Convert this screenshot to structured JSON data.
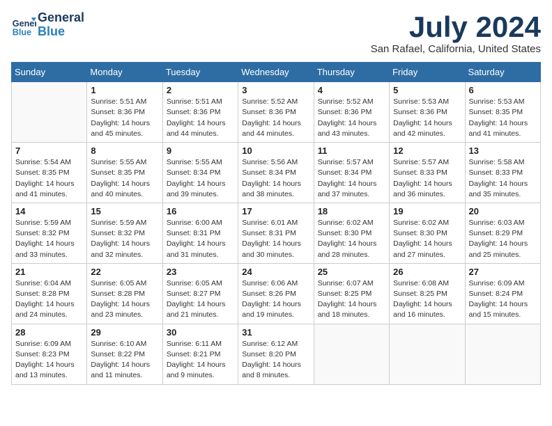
{
  "header": {
    "logo_general": "General",
    "logo_blue": "Blue",
    "month": "July 2024",
    "location": "San Rafael, California, United States"
  },
  "weekdays": [
    "Sunday",
    "Monday",
    "Tuesday",
    "Wednesday",
    "Thursday",
    "Friday",
    "Saturday"
  ],
  "weeks": [
    [
      {
        "day": "",
        "sunrise": "",
        "sunset": "",
        "daylight": ""
      },
      {
        "day": "1",
        "sunrise": "Sunrise: 5:51 AM",
        "sunset": "Sunset: 8:36 PM",
        "daylight": "Daylight: 14 hours and 45 minutes."
      },
      {
        "day": "2",
        "sunrise": "Sunrise: 5:51 AM",
        "sunset": "Sunset: 8:36 PM",
        "daylight": "Daylight: 14 hours and 44 minutes."
      },
      {
        "day": "3",
        "sunrise": "Sunrise: 5:52 AM",
        "sunset": "Sunset: 8:36 PM",
        "daylight": "Daylight: 14 hours and 44 minutes."
      },
      {
        "day": "4",
        "sunrise": "Sunrise: 5:52 AM",
        "sunset": "Sunset: 8:36 PM",
        "daylight": "Daylight: 14 hours and 43 minutes."
      },
      {
        "day": "5",
        "sunrise": "Sunrise: 5:53 AM",
        "sunset": "Sunset: 8:36 PM",
        "daylight": "Daylight: 14 hours and 42 minutes."
      },
      {
        "day": "6",
        "sunrise": "Sunrise: 5:53 AM",
        "sunset": "Sunset: 8:35 PM",
        "daylight": "Daylight: 14 hours and 41 minutes."
      }
    ],
    [
      {
        "day": "7",
        "sunrise": "Sunrise: 5:54 AM",
        "sunset": "Sunset: 8:35 PM",
        "daylight": "Daylight: 14 hours and 41 minutes."
      },
      {
        "day": "8",
        "sunrise": "Sunrise: 5:55 AM",
        "sunset": "Sunset: 8:35 PM",
        "daylight": "Daylight: 14 hours and 40 minutes."
      },
      {
        "day": "9",
        "sunrise": "Sunrise: 5:55 AM",
        "sunset": "Sunset: 8:34 PM",
        "daylight": "Daylight: 14 hours and 39 minutes."
      },
      {
        "day": "10",
        "sunrise": "Sunrise: 5:56 AM",
        "sunset": "Sunset: 8:34 PM",
        "daylight": "Daylight: 14 hours and 38 minutes."
      },
      {
        "day": "11",
        "sunrise": "Sunrise: 5:57 AM",
        "sunset": "Sunset: 8:34 PM",
        "daylight": "Daylight: 14 hours and 37 minutes."
      },
      {
        "day": "12",
        "sunrise": "Sunrise: 5:57 AM",
        "sunset": "Sunset: 8:33 PM",
        "daylight": "Daylight: 14 hours and 36 minutes."
      },
      {
        "day": "13",
        "sunrise": "Sunrise: 5:58 AM",
        "sunset": "Sunset: 8:33 PM",
        "daylight": "Daylight: 14 hours and 35 minutes."
      }
    ],
    [
      {
        "day": "14",
        "sunrise": "Sunrise: 5:59 AM",
        "sunset": "Sunset: 8:32 PM",
        "daylight": "Daylight: 14 hours and 33 minutes."
      },
      {
        "day": "15",
        "sunrise": "Sunrise: 5:59 AM",
        "sunset": "Sunset: 8:32 PM",
        "daylight": "Daylight: 14 hours and 32 minutes."
      },
      {
        "day": "16",
        "sunrise": "Sunrise: 6:00 AM",
        "sunset": "Sunset: 8:31 PM",
        "daylight": "Daylight: 14 hours and 31 minutes."
      },
      {
        "day": "17",
        "sunrise": "Sunrise: 6:01 AM",
        "sunset": "Sunset: 8:31 PM",
        "daylight": "Daylight: 14 hours and 30 minutes."
      },
      {
        "day": "18",
        "sunrise": "Sunrise: 6:02 AM",
        "sunset": "Sunset: 8:30 PM",
        "daylight": "Daylight: 14 hours and 28 minutes."
      },
      {
        "day": "19",
        "sunrise": "Sunrise: 6:02 AM",
        "sunset": "Sunset: 8:30 PM",
        "daylight": "Daylight: 14 hours and 27 minutes."
      },
      {
        "day": "20",
        "sunrise": "Sunrise: 6:03 AM",
        "sunset": "Sunset: 8:29 PM",
        "daylight": "Daylight: 14 hours and 25 minutes."
      }
    ],
    [
      {
        "day": "21",
        "sunrise": "Sunrise: 6:04 AM",
        "sunset": "Sunset: 8:28 PM",
        "daylight": "Daylight: 14 hours and 24 minutes."
      },
      {
        "day": "22",
        "sunrise": "Sunrise: 6:05 AM",
        "sunset": "Sunset: 8:28 PM",
        "daylight": "Daylight: 14 hours and 23 minutes."
      },
      {
        "day": "23",
        "sunrise": "Sunrise: 6:05 AM",
        "sunset": "Sunset: 8:27 PM",
        "daylight": "Daylight: 14 hours and 21 minutes."
      },
      {
        "day": "24",
        "sunrise": "Sunrise: 6:06 AM",
        "sunset": "Sunset: 8:26 PM",
        "daylight": "Daylight: 14 hours and 19 minutes."
      },
      {
        "day": "25",
        "sunrise": "Sunrise: 6:07 AM",
        "sunset": "Sunset: 8:25 PM",
        "daylight": "Daylight: 14 hours and 18 minutes."
      },
      {
        "day": "26",
        "sunrise": "Sunrise: 6:08 AM",
        "sunset": "Sunset: 8:25 PM",
        "daylight": "Daylight: 14 hours and 16 minutes."
      },
      {
        "day": "27",
        "sunrise": "Sunrise: 6:09 AM",
        "sunset": "Sunset: 8:24 PM",
        "daylight": "Daylight: 14 hours and 15 minutes."
      }
    ],
    [
      {
        "day": "28",
        "sunrise": "Sunrise: 6:09 AM",
        "sunset": "Sunset: 8:23 PM",
        "daylight": "Daylight: 14 hours and 13 minutes."
      },
      {
        "day": "29",
        "sunrise": "Sunrise: 6:10 AM",
        "sunset": "Sunset: 8:22 PM",
        "daylight": "Daylight: 14 hours and 11 minutes."
      },
      {
        "day": "30",
        "sunrise": "Sunrise: 6:11 AM",
        "sunset": "Sunset: 8:21 PM",
        "daylight": "Daylight: 14 hours and 9 minutes."
      },
      {
        "day": "31",
        "sunrise": "Sunrise: 6:12 AM",
        "sunset": "Sunset: 8:20 PM",
        "daylight": "Daylight: 14 hours and 8 minutes."
      },
      {
        "day": "",
        "sunrise": "",
        "sunset": "",
        "daylight": ""
      },
      {
        "day": "",
        "sunrise": "",
        "sunset": "",
        "daylight": ""
      },
      {
        "day": "",
        "sunrise": "",
        "sunset": "",
        "daylight": ""
      }
    ]
  ]
}
